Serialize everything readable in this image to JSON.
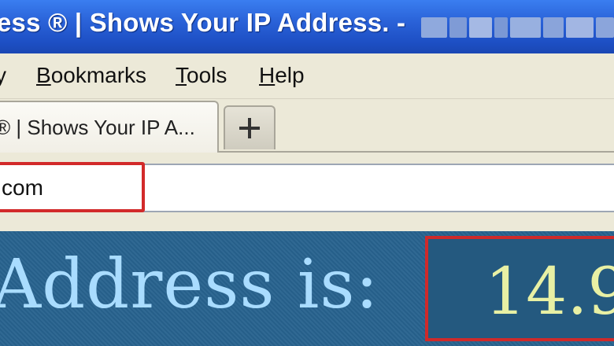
{
  "window": {
    "title": "ess ® | Shows Your IP Address. -"
  },
  "menu": {
    "items": [
      {
        "prefix": "",
        "accel": "",
        "rest": "y"
      },
      {
        "prefix": "",
        "accel": "B",
        "rest": "ookmarks"
      },
      {
        "prefix": "",
        "accel": "T",
        "rest": "ools"
      },
      {
        "prefix": "",
        "accel": "H",
        "rest": "elp"
      }
    ]
  },
  "tabs": {
    "active_label": "® | Shows Your IP A...",
    "new_tab_icon": "plus-icon"
  },
  "address_bar": {
    "url": "com"
  },
  "page": {
    "label": "Address is:",
    "ip_value": "14.9"
  },
  "colors": {
    "titlebar": "#2a62d8",
    "highlight": "#d22a2a",
    "page_bg": "#28638f",
    "label_text": "#a9dcff",
    "ip_text": "#e8f0a4"
  }
}
